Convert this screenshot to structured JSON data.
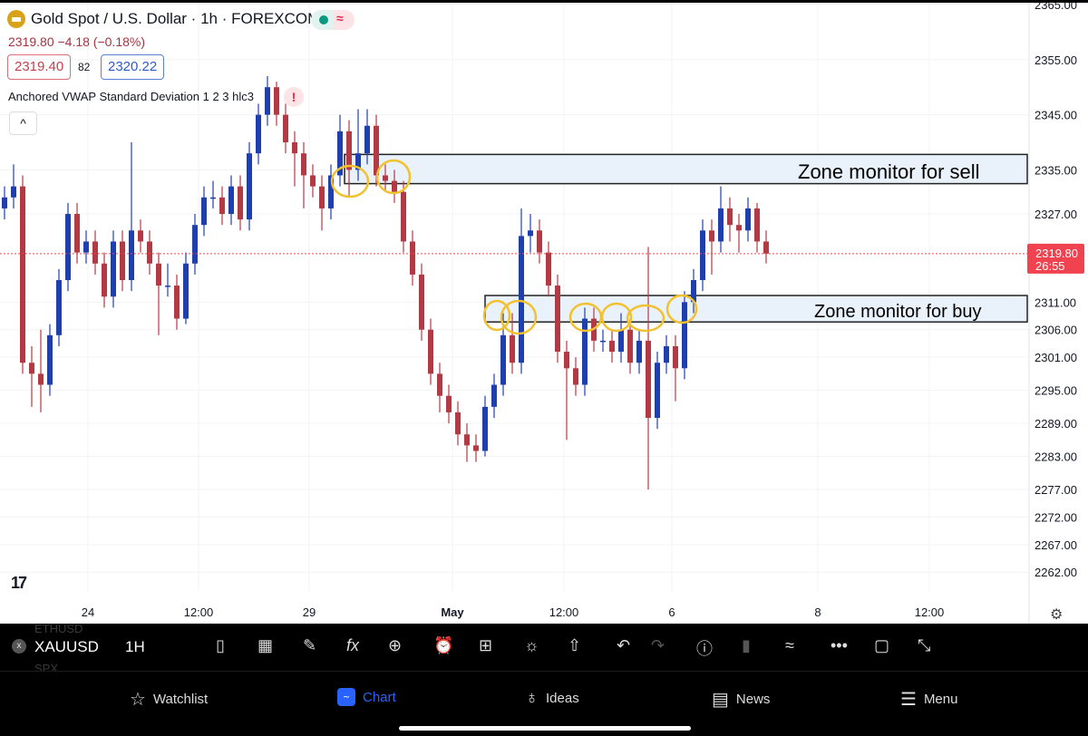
{
  "header": {
    "title": "Gold Spot / U.S. Dollar · 1h · FOREXCOM",
    "price_change": "2319.80  −4.18 (−0.18%)",
    "bid": "2319.40",
    "spread": "82",
    "ask": "2320.22",
    "indicator": "Anchored VWAP Standard Deviation 1 2 3 hlc3",
    "warning_icon": "!",
    "collapse_icon": "^",
    "logo_text": "TV"
  },
  "price_tag": {
    "price": "2319.80",
    "countdown": "26:55"
  },
  "annotations": {
    "sell_zone_label": "Zone monitor for sell",
    "buy_zone_label": "Zone monitor for buy",
    "sell_zone": [
      2332.5,
      2337.8
    ],
    "buy_zone": [
      2307.4,
      2312.2
    ],
    "highlight_color": "#f2c12e"
  },
  "colors": {
    "up": "#1f3fae",
    "down": "#b23a45",
    "last_price": "#f0434f",
    "zone_fill": "#e9f1fb"
  },
  "toolbar": {
    "symbol": "XAUUSD",
    "interval": "1H",
    "prev_symbol": "ETHUSD",
    "next_symbol": "SPX"
  },
  "nav": {
    "watchlist": "Watchlist",
    "chart": "Chart",
    "ideas": "Ideas",
    "news": "News",
    "menu": "Menu"
  },
  "chart_data": {
    "type": "candlestick",
    "ylim": [
      2260,
      2366
    ],
    "y_ticks": [
      "2365.00",
      "2355.00",
      "2345.00",
      "2335.00",
      "2327.00",
      "2311.00",
      "2306.00",
      "2301.00",
      "2295.00",
      "2289.00",
      "2283.00",
      "2277.00",
      "2272.00",
      "2267.00",
      "2262.00"
    ],
    "x_ticks": [
      "24",
      "12:00",
      "29",
      "May",
      "12:00",
      "6",
      "8",
      "12:00"
    ],
    "last_price": 2319.8,
    "candles": [
      [
        2328,
        2332,
        2326,
        2330
      ],
      [
        2330,
        2336,
        2328,
        2332
      ],
      [
        2332,
        2334,
        2298,
        2300
      ],
      [
        2300,
        2303,
        2292,
        2298
      ],
      [
        2298,
        2306,
        2291,
        2296
      ],
      [
        2296,
        2307,
        2294,
        2305
      ],
      [
        2305,
        2317,
        2303,
        2315
      ],
      [
        2315,
        2329,
        2313,
        2327
      ],
      [
        2327,
        2329,
        2318,
        2320
      ],
      [
        2320,
        2324,
        2318,
        2322
      ],
      [
        2322,
        2324,
        2316,
        2318
      ],
      [
        2318,
        2320,
        2310,
        2312
      ],
      [
        2312,
        2324,
        2310,
        2322
      ],
      [
        2322,
        2324,
        2313,
        2315
      ],
      [
        2315,
        2340,
        2313,
        2324
      ],
      [
        2324,
        2326,
        2320,
        2322
      ],
      [
        2322,
        2324,
        2316,
        2318
      ],
      [
        2318,
        2320,
        2305,
        2314
      ],
      [
        2314,
        2318,
        2312,
        2314
      ],
      [
        2314,
        2316,
        2306,
        2308
      ],
      [
        2308,
        2320,
        2307,
        2318
      ],
      [
        2318,
        2327,
        2316,
        2325
      ],
      [
        2325,
        2332,
        2323,
        2330
      ],
      [
        2330,
        2333,
        2328,
        2330
      ],
      [
        2330,
        2332,
        2325,
        2327
      ],
      [
        2327,
        2334,
        2325,
        2332
      ],
      [
        2332,
        2334,
        2324,
        2326
      ],
      [
        2326,
        2340,
        2324,
        2338
      ],
      [
        2338,
        2347,
        2336,
        2345
      ],
      [
        2345,
        2352,
        2343,
        2350
      ],
      [
        2350,
        2351,
        2343,
        2345
      ],
      [
        2345,
        2347,
        2338,
        2340
      ],
      [
        2340,
        2342,
        2332,
        2338
      ],
      [
        2338,
        2340,
        2328,
        2334
      ],
      [
        2334,
        2336,
        2330,
        2332
      ],
      [
        2332,
        2334,
        2324,
        2328
      ],
      [
        2328,
        2336,
        2326,
        2334
      ],
      [
        2334,
        2345,
        2332,
        2342
      ],
      [
        2342,
        2344,
        2330,
        2335
      ],
      [
        2335,
        2346,
        2333,
        2338
      ],
      [
        2338,
        2346,
        2336,
        2343
      ],
      [
        2343,
        2345,
        2332,
        2334
      ],
      [
        2334,
        2336,
        2331,
        2333
      ],
      [
        2333,
        2335,
        2329,
        2331
      ],
      [
        2331,
        2333,
        2320,
        2322
      ],
      [
        2322,
        2324,
        2314,
        2316
      ],
      [
        2316,
        2318,
        2304,
        2306
      ],
      [
        2306,
        2308,
        2296,
        2298
      ],
      [
        2298,
        2300,
        2291,
        2294
      ],
      [
        2294,
        2296,
        2289,
        2291
      ],
      [
        2291,
        2293,
        2285,
        2287
      ],
      [
        2287,
        2289,
        2282,
        2285
      ],
      [
        2285,
        2287,
        2282,
        2284
      ],
      [
        2284,
        2294,
        2283,
        2292
      ],
      [
        2292,
        2298,
        2290,
        2296
      ],
      [
        2296,
        2309,
        2294,
        2305
      ],
      [
        2305,
        2309,
        2298,
        2300
      ],
      [
        2300,
        2328,
        2298,
        2323
      ],
      [
        2323,
        2327,
        2320,
        2324
      ],
      [
        2324,
        2326,
        2318,
        2320
      ],
      [
        2320,
        2322,
        2312,
        2314
      ],
      [
        2314,
        2316,
        2300,
        2302
      ],
      [
        2302,
        2304,
        2286,
        2299
      ],
      [
        2299,
        2301,
        2294,
        2296
      ],
      [
        2296,
        2310,
        2294,
        2308
      ],
      [
        2308,
        2310,
        2302,
        2304
      ],
      [
        2304,
        2306,
        2302,
        2304
      ],
      [
        2304,
        2306,
        2300,
        2302
      ],
      [
        2302,
        2309,
        2300,
        2306
      ],
      [
        2306,
        2308,
        2298,
        2300
      ],
      [
        2300,
        2306,
        2298,
        2304
      ],
      [
        2304,
        2321,
        2277,
        2290
      ],
      [
        2290,
        2302,
        2288,
        2300
      ],
      [
        2300,
        2305,
        2298,
        2303
      ],
      [
        2303,
        2305,
        2293,
        2299
      ],
      [
        2299,
        2313,
        2297,
        2311
      ],
      [
        2311,
        2317,
        2309,
        2315
      ],
      [
        2315,
        2326,
        2313,
        2324
      ],
      [
        2324,
        2326,
        2316,
        2322
      ],
      [
        2322,
        2332,
        2320,
        2328
      ],
      [
        2328,
        2330,
        2322,
        2325
      ],
      [
        2325,
        2327,
        2320,
        2324
      ],
      [
        2324,
        2330,
        2322,
        2328
      ],
      [
        2328,
        2329,
        2320,
        2322
      ],
      [
        2322,
        2324,
        2318,
        2319.8
      ]
    ]
  }
}
